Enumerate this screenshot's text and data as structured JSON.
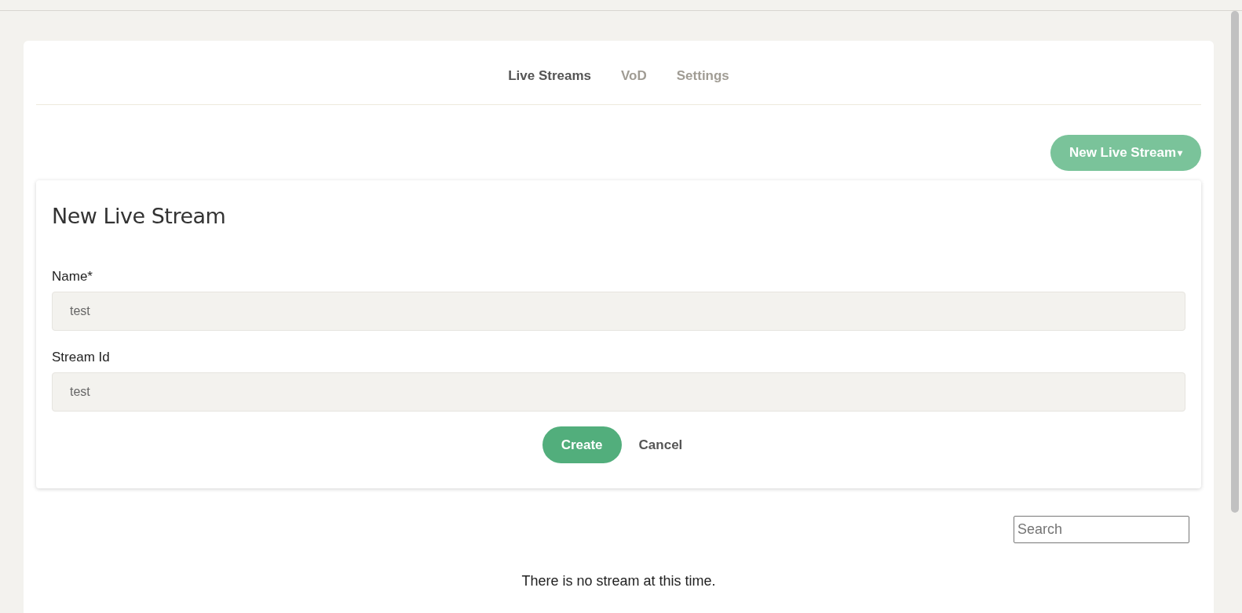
{
  "tabs": [
    {
      "label": "Live Streams",
      "selected": true
    },
    {
      "label": "VoD",
      "selected": false
    },
    {
      "label": "Settings",
      "selected": false
    }
  ],
  "new_button": {
    "label": "New Live Stream",
    "caret": "▾"
  },
  "form": {
    "title": "New Live Stream",
    "fields": [
      {
        "label": "Name*",
        "value": "test"
      },
      {
        "label": "Stream Id",
        "value": "test"
      }
    ],
    "create": "Create",
    "cancel": "Cancel"
  },
  "search": {
    "placeholder": "Search"
  },
  "empty_message": "There is no stream at this time."
}
